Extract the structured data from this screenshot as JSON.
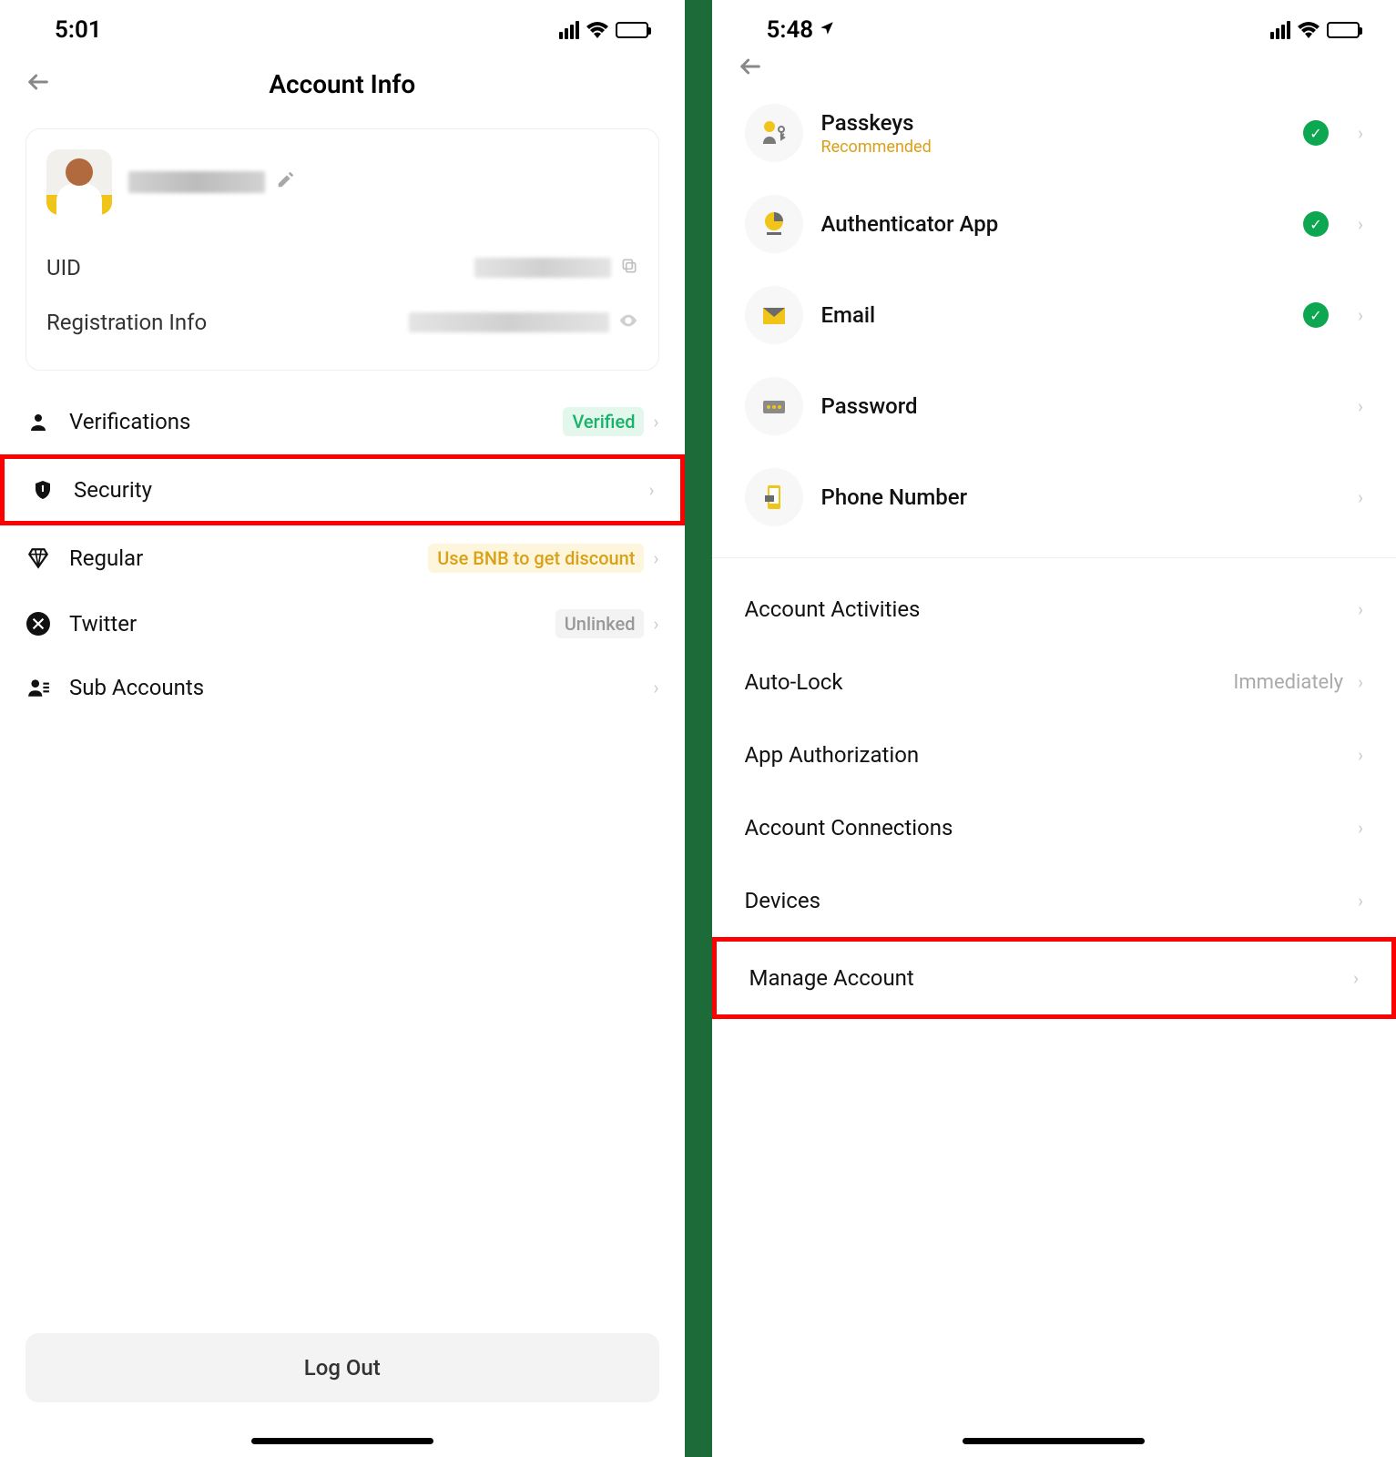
{
  "left": {
    "status": {
      "time": "5:01"
    },
    "header": {
      "title": "Account Info"
    },
    "profile": {
      "uid_label": "UID",
      "reg_label": "Registration Info"
    },
    "menu": {
      "verifications": {
        "label": "Verifications",
        "badge": "Verified"
      },
      "security": {
        "label": "Security"
      },
      "regular": {
        "label": "Regular",
        "badge": "Use BNB to get discount"
      },
      "twitter": {
        "label": "Twitter",
        "badge": "Unlinked"
      },
      "sub_accounts": {
        "label": "Sub Accounts"
      }
    },
    "logout": "Log Out"
  },
  "right": {
    "status": {
      "time": "5:48"
    },
    "security_methods": {
      "passkeys": {
        "title": "Passkeys",
        "sub": "Recommended",
        "verified": true
      },
      "authenticator": {
        "title": "Authenticator App",
        "verified": true
      },
      "email": {
        "title": "Email",
        "verified": true
      },
      "password": {
        "title": "Password",
        "verified": false
      },
      "phone": {
        "title": "Phone Number",
        "verified": false
      }
    },
    "items": {
      "activities": "Account Activities",
      "autolock": {
        "label": "Auto-Lock",
        "value": "Immediately"
      },
      "app_auth": "App Authorization",
      "connections": "Account Connections",
      "devices": "Devices",
      "manage": "Manage Account"
    }
  }
}
